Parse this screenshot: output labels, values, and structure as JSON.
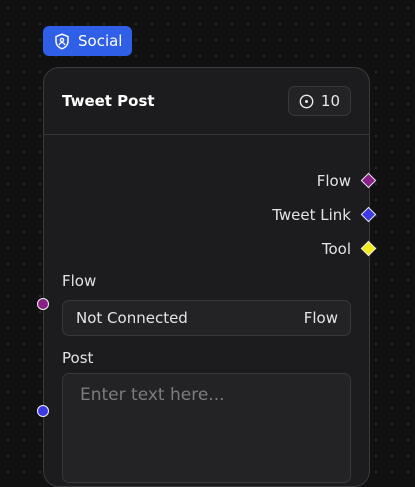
{
  "category": {
    "label": "Social",
    "icon": "shield-icon",
    "color": "#2f5fe6"
  },
  "node": {
    "title": "Tweet Post",
    "credits": {
      "icon": "clock-icon",
      "value": "10"
    },
    "outputs": [
      {
        "label": "Flow",
        "color": "#8a1f87"
      },
      {
        "label": "Tweet Link",
        "color": "#3b3be6"
      },
      {
        "label": "Tool",
        "color": "#f2ea1b"
      }
    ],
    "inputs": {
      "flow": {
        "label": "Flow",
        "status": "Not Connected",
        "type": "Flow",
        "handle_color": "#8a1f87"
      },
      "post": {
        "label": "Post",
        "placeholder": "Enter text here...",
        "value": "",
        "handle_color": "#3b3be6"
      }
    }
  }
}
